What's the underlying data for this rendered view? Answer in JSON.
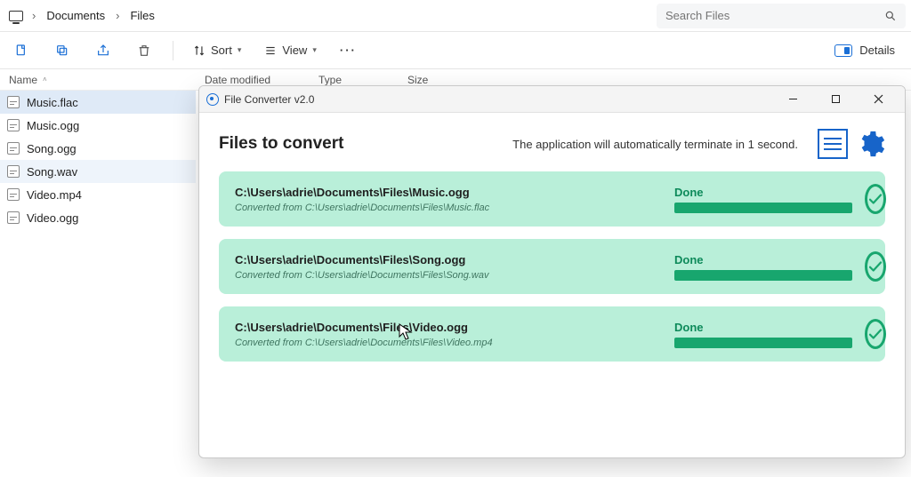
{
  "breadcrumb": {
    "seg1": "Documents",
    "seg2": "Files"
  },
  "search": {
    "placeholder": "Search Files"
  },
  "toolbar": {
    "sort": "Sort",
    "view": "View",
    "details": "Details"
  },
  "columns": {
    "name": "Name",
    "date": "Date modified",
    "type": "Type",
    "size": "Size"
  },
  "files": [
    {
      "name": "Music.flac",
      "selected": true
    },
    {
      "name": "Music.ogg",
      "selected": false
    },
    {
      "name": "Song.ogg",
      "selected": false
    },
    {
      "name": "Song.wav",
      "selected": false,
      "hover": true
    },
    {
      "name": "Video.mp4",
      "selected": false
    },
    {
      "name": "Video.ogg",
      "selected": false
    }
  ],
  "modal": {
    "title": "File Converter v2.0",
    "heading": "Files to convert",
    "terminate_msg": "The application will automatically terminate in 1 second.",
    "jobs": [
      {
        "path": "C:\\Users\\adrie\\Documents\\Files\\Music.ogg",
        "sub_prefix": "Converted from",
        "sub_path": "C:\\Users\\adrie\\Documents\\Files\\Music.flac",
        "status": "Done"
      },
      {
        "path": "C:\\Users\\adrie\\Documents\\Files\\Song.ogg",
        "sub_prefix": "Converted from",
        "sub_path": "C:\\Users\\adrie\\Documents\\Files\\Song.wav",
        "status": "Done"
      },
      {
        "path": "C:\\Users\\adrie\\Documents\\Files\\Video.ogg",
        "sub_prefix": "Converted from",
        "sub_path": "C:\\Users\\adrie\\Documents\\Files\\Video.mp4",
        "status": "Done"
      }
    ]
  }
}
